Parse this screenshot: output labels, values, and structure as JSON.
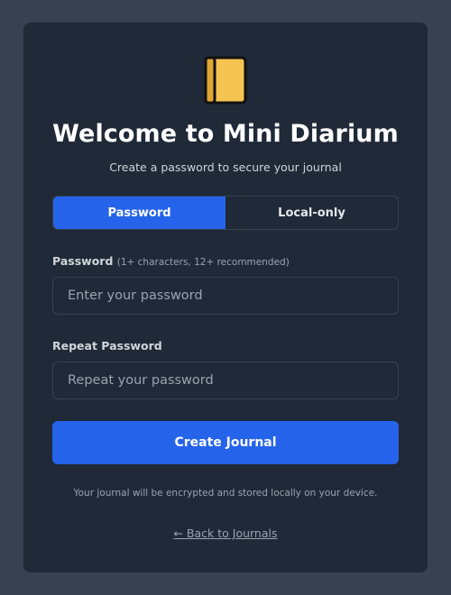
{
  "logo": {
    "icon": "notebook-icon",
    "color": "#f5c451"
  },
  "header": {
    "title": "Welcome to Mini Diarium",
    "subtitle": "Create a password to secure your journal"
  },
  "mode_tabs": {
    "items": [
      {
        "label": "Password",
        "selected": true
      },
      {
        "label": "Local-only",
        "selected": false
      }
    ]
  },
  "form": {
    "password": {
      "label": "Password",
      "hint": "(1+ characters, 12+ recommended)",
      "placeholder": "Enter your password",
      "value": ""
    },
    "repeat": {
      "label": "Repeat Password",
      "placeholder": "Repeat your password",
      "value": ""
    },
    "submit_label": "Create Journal"
  },
  "footer": {
    "note": "Your journal will be encrypted and stored locally on your device.",
    "back_link": "← Back to Journals"
  },
  "colors": {
    "accent": "#2563eb",
    "background": "#374151",
    "card": "#1f2937"
  }
}
